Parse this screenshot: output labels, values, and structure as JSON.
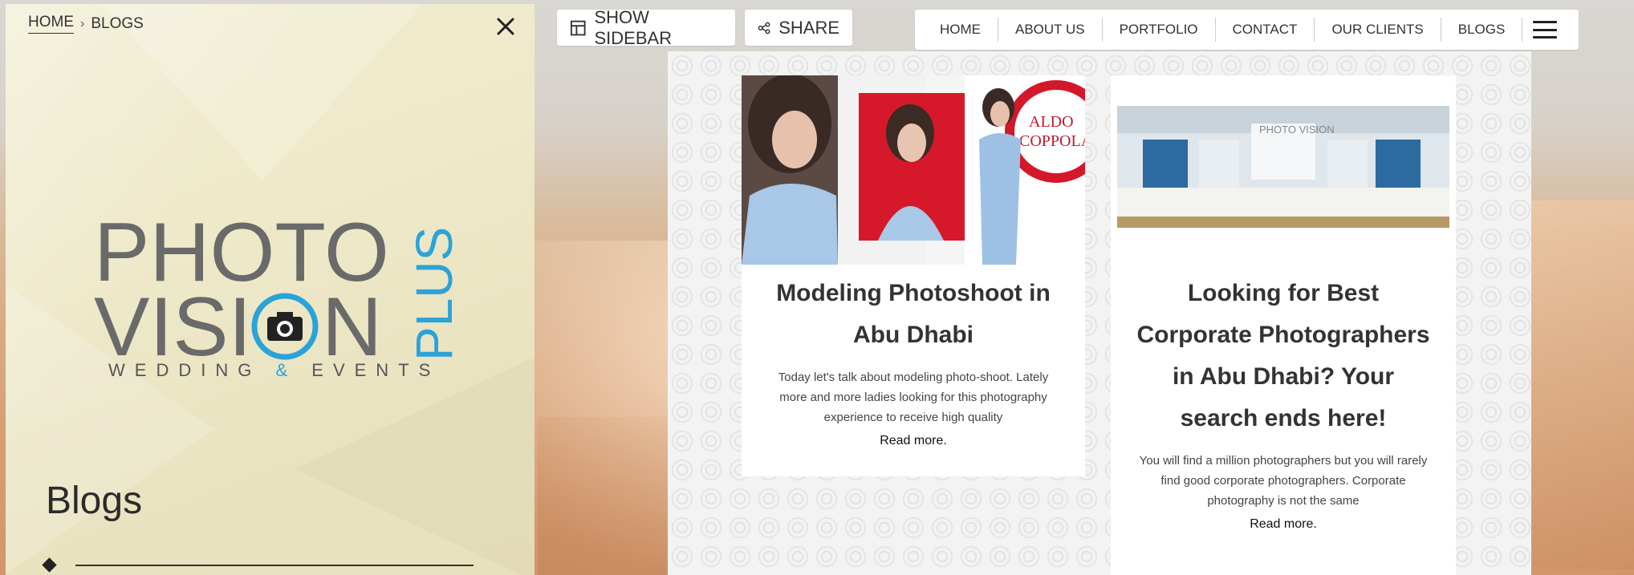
{
  "breadcrumb": {
    "home": "HOME",
    "separator": "›",
    "current": "BLOGS"
  },
  "sidebar": {
    "logo_line1": "PHOTO",
    "logo_line2a": "VISI",
    "logo_line2b": "N",
    "logo_vertical": "PLUS",
    "tagline_a": "WEDDING",
    "tagline_amp": "&",
    "tagline_b": "EVENTS",
    "title": "Blogs"
  },
  "toolbar": {
    "show_sidebar": "SHOW SIDEBAR",
    "share": "SHARE"
  },
  "nav": {
    "items": [
      "HOME",
      "ABOUT US",
      "PORTFOLIO",
      "CONTACT",
      "OUR CLIENTS",
      "BLOGS"
    ]
  },
  "posts": [
    {
      "title": "Modeling Photoshoot in Abu Dhabi",
      "excerpt": "Today let's talk about modeling photo-shoot. Lately more and more ladies looking for this photography experience to receive high quality",
      "read_more": "Read more.",
      "image_sign": "ALDO COPPOLA"
    },
    {
      "title": "Looking for Best Corporate Photographers in Abu Dhabi? Your search ends here!",
      "excerpt": "You will find a million photographers but you will rarely find good corporate photographers. Corporate photography is not the same",
      "read_more": "Read more.",
      "image_banner": "PHOTO VISION"
    }
  ],
  "colors": {
    "accent_blue": "#2aa3d8",
    "logo_gray": "#6a6a6a",
    "sidebar_bg": "#eee9c9"
  }
}
